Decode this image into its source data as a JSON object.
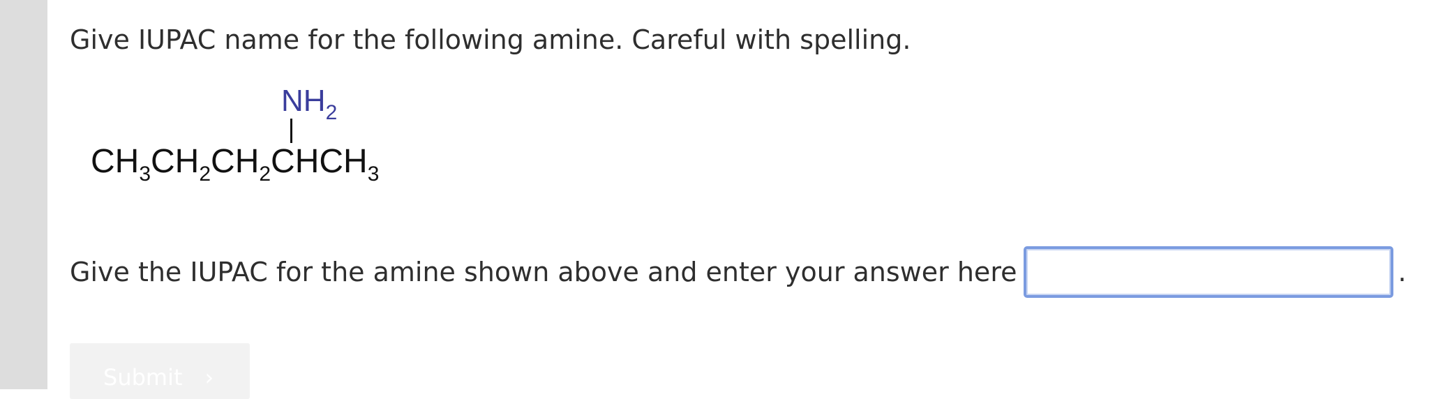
{
  "question": {
    "text": "Give IUPAC name for the following amine. Careful with spelling."
  },
  "structure": {
    "substituent": "NH",
    "substituent_subscript": "2",
    "chain_parts": [
      {
        "text": "CH",
        "sub": "3"
      },
      {
        "text": "CH",
        "sub": "2"
      },
      {
        "text": "CH",
        "sub": "2"
      },
      {
        "text": "CHCH",
        "sub": "3"
      }
    ]
  },
  "prompt": {
    "text": "Give the IUPAC for the amine shown above and enter your answer here",
    "answer_value": "",
    "trailing": "."
  },
  "submit": {
    "label": "Submit",
    "chevron": "›"
  },
  "colors": {
    "substituent": "#3a3d9c",
    "input_border": "#7b9be0",
    "left_bar": "#dddddd"
  }
}
